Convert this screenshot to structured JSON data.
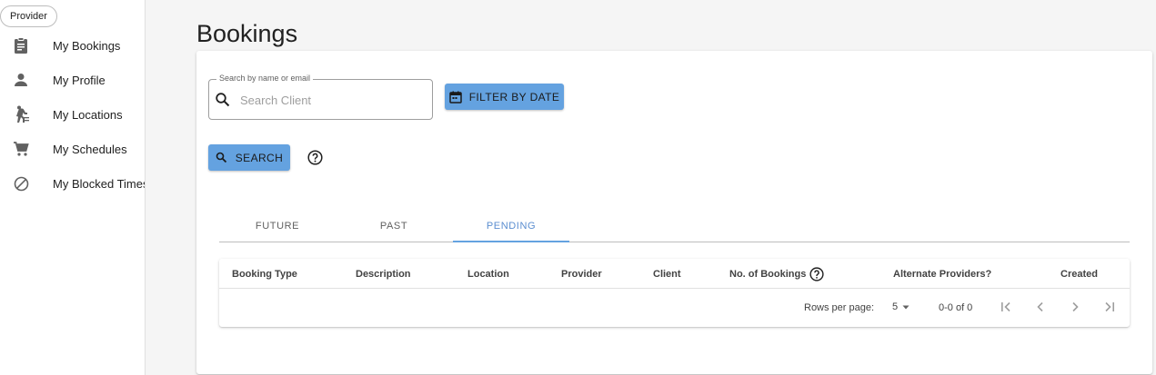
{
  "sidebar": {
    "role_chip": "Provider",
    "items": [
      {
        "label": "My Bookings",
        "icon": "clipboard-icon"
      },
      {
        "label": "My Profile",
        "icon": "person-icon"
      },
      {
        "label": "My Locations",
        "icon": "walking-person-icon"
      },
      {
        "label": "My Schedules",
        "icon": "cart-icon"
      },
      {
        "label": "My Blocked Times",
        "icon": "block-icon"
      }
    ]
  },
  "main": {
    "title": "Bookings",
    "search": {
      "legend": "Search by name or email",
      "placeholder": "Search Client",
      "value": ""
    },
    "filter_button": "Filter by date",
    "search_button": "Search",
    "tabs": [
      {
        "label": "Future",
        "active": false
      },
      {
        "label": "Past",
        "active": false
      },
      {
        "label": "Pending",
        "active": true
      }
    ],
    "table": {
      "columns": [
        "Booking Type",
        "Description",
        "Location",
        "Provider",
        "Client",
        "No. of Bookings",
        "Alternate Providers?",
        "Created"
      ],
      "rows": [],
      "pagination": {
        "rows_per_page_label": "Rows per page:",
        "rows_per_page": "5",
        "range": "0-0 of 0"
      }
    }
  },
  "colors": {
    "accent": "#64a2e0",
    "active_tab": "#5b8ed0",
    "background": "#f5f5f5"
  }
}
